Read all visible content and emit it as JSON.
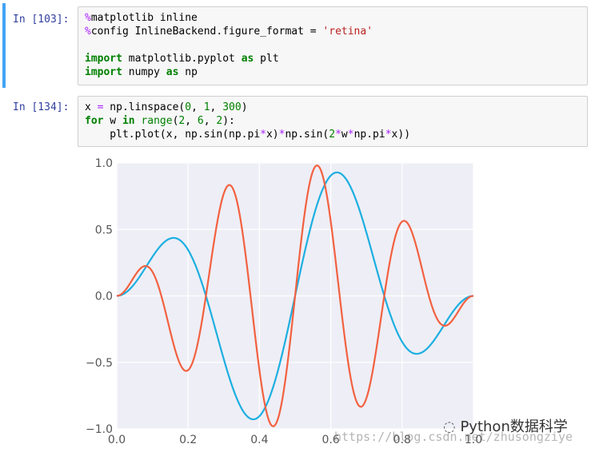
{
  "cells": [
    {
      "prompt": "In [103]:",
      "lines": [
        [
          [
            "magic",
            "%"
          ],
          [
            "plain",
            "matplotlib inline"
          ]
        ],
        [
          [
            "magic",
            "%"
          ],
          [
            "plain",
            "config InlineBackend.figure_format = "
          ],
          [
            "str",
            "'retina'"
          ]
        ],
        [
          [
            "plain",
            ""
          ]
        ],
        [
          [
            "kw",
            "import"
          ],
          [
            "plain",
            " matplotlib.pyplot "
          ],
          [
            "kw",
            "as"
          ],
          [
            "plain",
            " plt"
          ]
        ],
        [
          [
            "kw",
            "import"
          ],
          [
            "plain",
            " numpy "
          ],
          [
            "kw",
            "as"
          ],
          [
            "plain",
            " np"
          ]
        ]
      ]
    },
    {
      "prompt": "In [134]:",
      "lines": [
        [
          [
            "plain",
            "x "
          ],
          [
            "op",
            "="
          ],
          [
            "plain",
            " np.linspace("
          ],
          [
            "num",
            "0"
          ],
          [
            "plain",
            ", "
          ],
          [
            "num",
            "1"
          ],
          [
            "plain",
            ", "
          ],
          [
            "num",
            "300"
          ],
          [
            "plain",
            ")"
          ]
        ],
        [
          [
            "kw",
            "for"
          ],
          [
            "plain",
            " w "
          ],
          [
            "kw",
            "in"
          ],
          [
            "plain",
            " "
          ],
          [
            "num",
            "range"
          ],
          [
            "plain",
            "("
          ],
          [
            "num",
            "2"
          ],
          [
            "plain",
            ", "
          ],
          [
            "num",
            "6"
          ],
          [
            "plain",
            ", "
          ],
          [
            "num",
            "2"
          ],
          [
            "plain",
            "):"
          ]
        ],
        [
          [
            "plain",
            "    plt.plot(x, np.sin(np.pi"
          ],
          [
            "op",
            "*"
          ],
          [
            "plain",
            "x)"
          ],
          [
            "op",
            "*"
          ],
          [
            "plain",
            "np.sin("
          ],
          [
            "num",
            "2"
          ],
          [
            "op",
            "*"
          ],
          [
            "plain",
            "w"
          ],
          [
            "op",
            "*"
          ],
          [
            "plain",
            "np.pi"
          ],
          [
            "op",
            "*"
          ],
          [
            "plain",
            "x))"
          ]
        ]
      ]
    }
  ],
  "chart_data": {
    "type": "line",
    "x_range": [
      0,
      1
    ],
    "y_range": [
      -1,
      1
    ],
    "x_ticks": [
      "0.0",
      "0.2",
      "0.4",
      "0.6",
      "0.8",
      "1.0"
    ],
    "y_ticks": [
      "1.0",
      "0.5",
      "0.0",
      "−0.5",
      "−1.0"
    ],
    "grid": true,
    "samples": 300,
    "series": [
      {
        "w": 2,
        "color": "#1CAFE0",
        "formula": "sin(pi*x)*sin(2*w*pi*x)"
      },
      {
        "w": 4,
        "color": "#F26140",
        "formula": "sin(pi*x)*sin(2*w*pi*x)"
      }
    ]
  },
  "watermark": {
    "brand": "Python数据科学",
    "url": "https://blog.csdn.net/zhusongziye"
  }
}
